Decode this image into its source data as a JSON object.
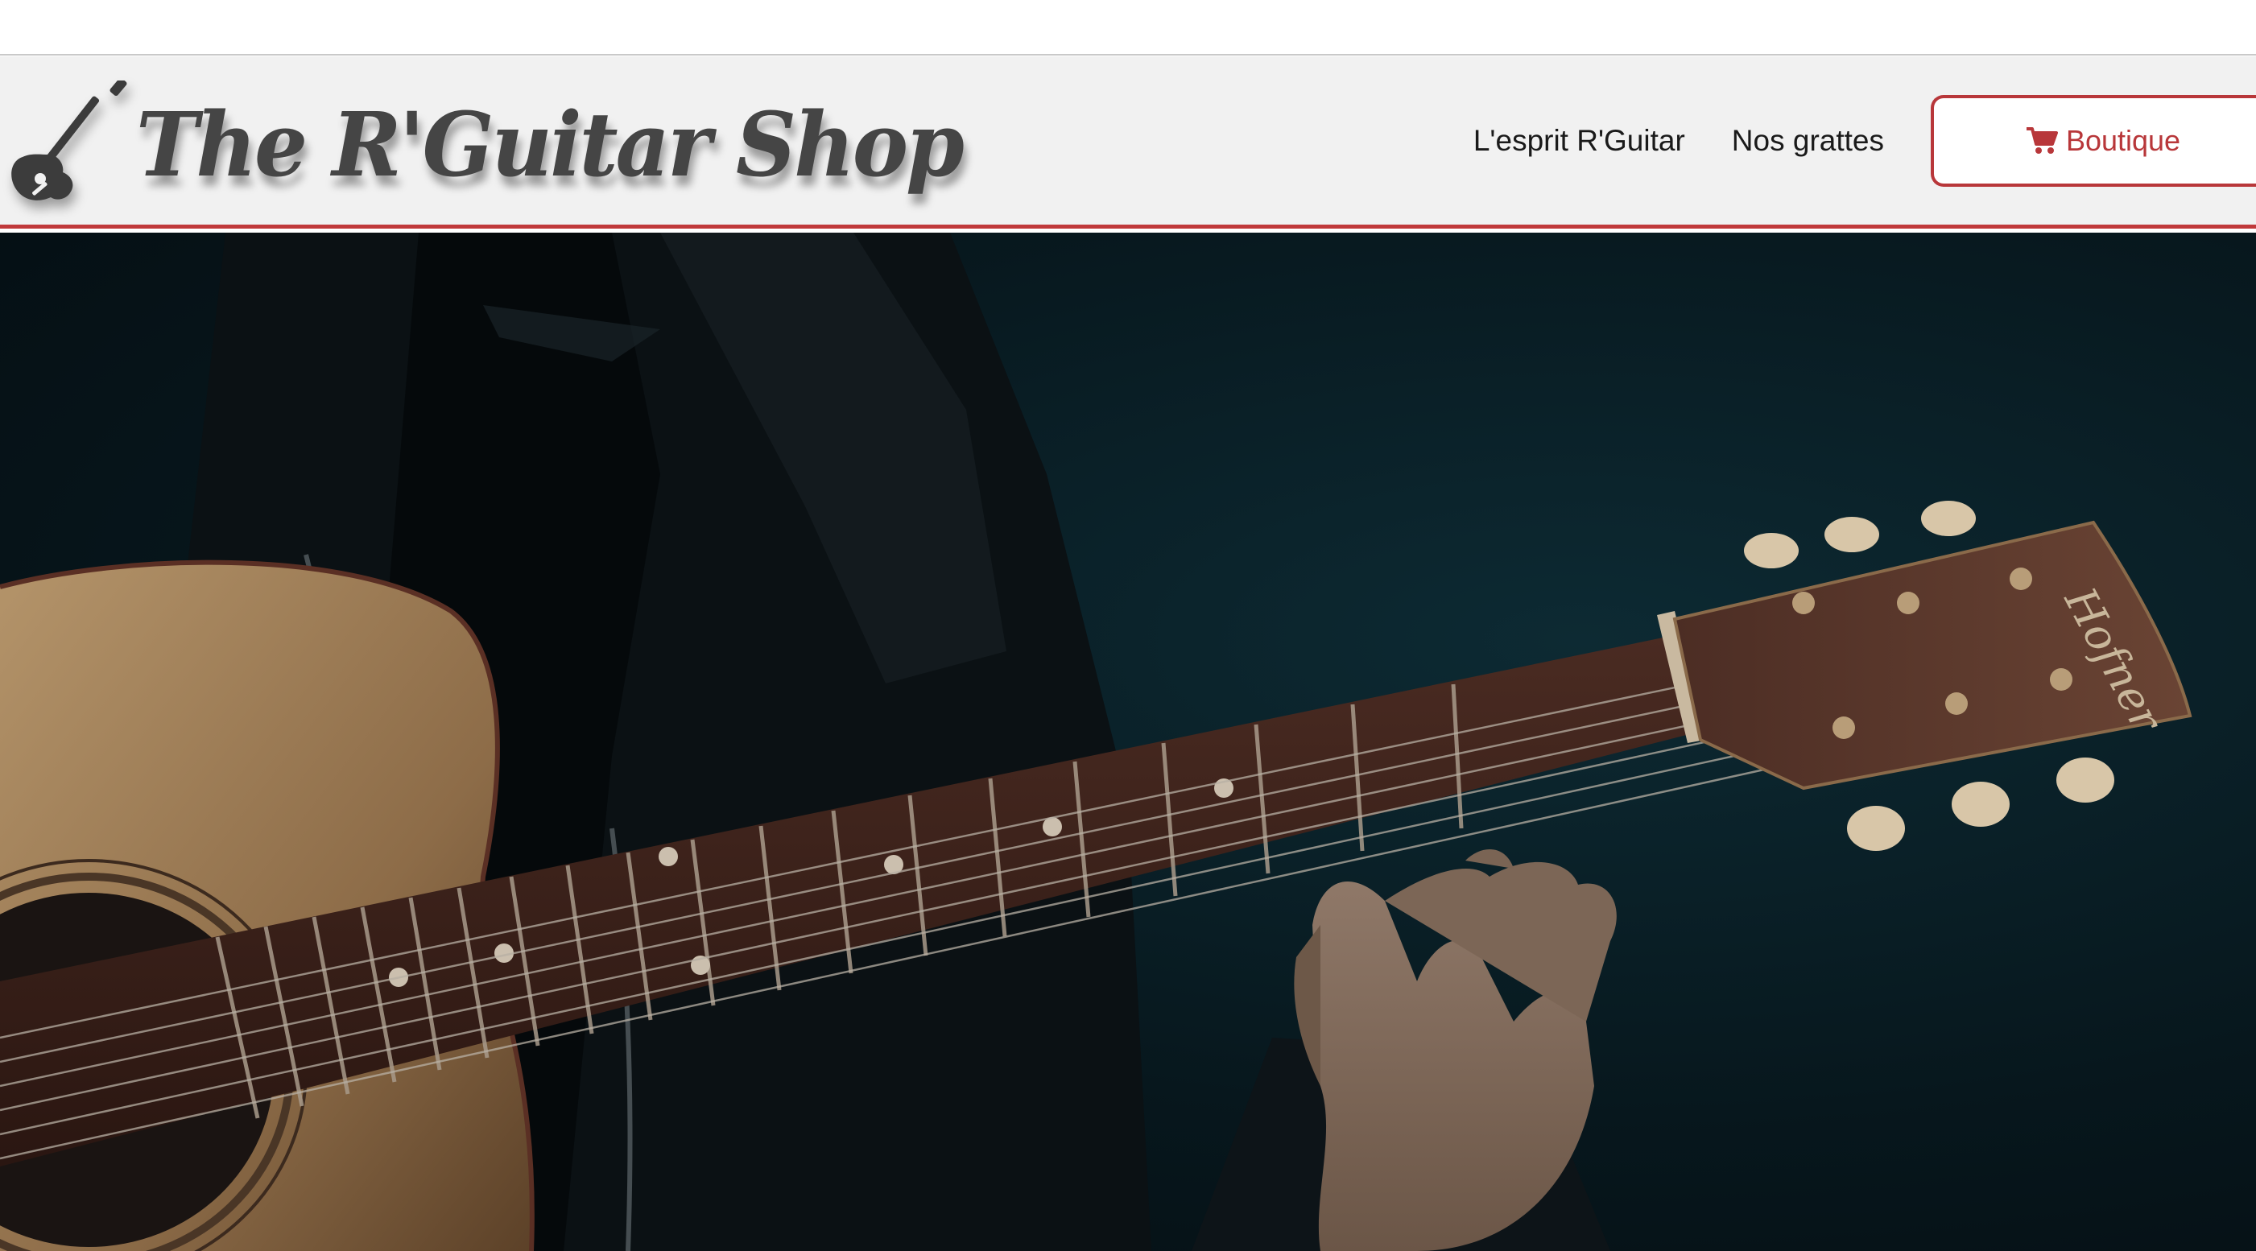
{
  "brand": {
    "name": "The R'Guitar Shop",
    "logo_icon": "guitar-icon"
  },
  "nav": {
    "links": [
      {
        "label": "L'esprit R'Guitar"
      },
      {
        "label": "Nos grattes"
      }
    ],
    "shop_button": {
      "label": "Boutique",
      "icon": "cart-icon"
    }
  },
  "hero": {
    "image_subject": "guitarist-playing-acoustic-guitar",
    "headstock_brand": "Hofner"
  },
  "colors": {
    "accent": "#c0393b",
    "navbar_bg": "#f1f1f1",
    "logo_text": "#454545"
  }
}
